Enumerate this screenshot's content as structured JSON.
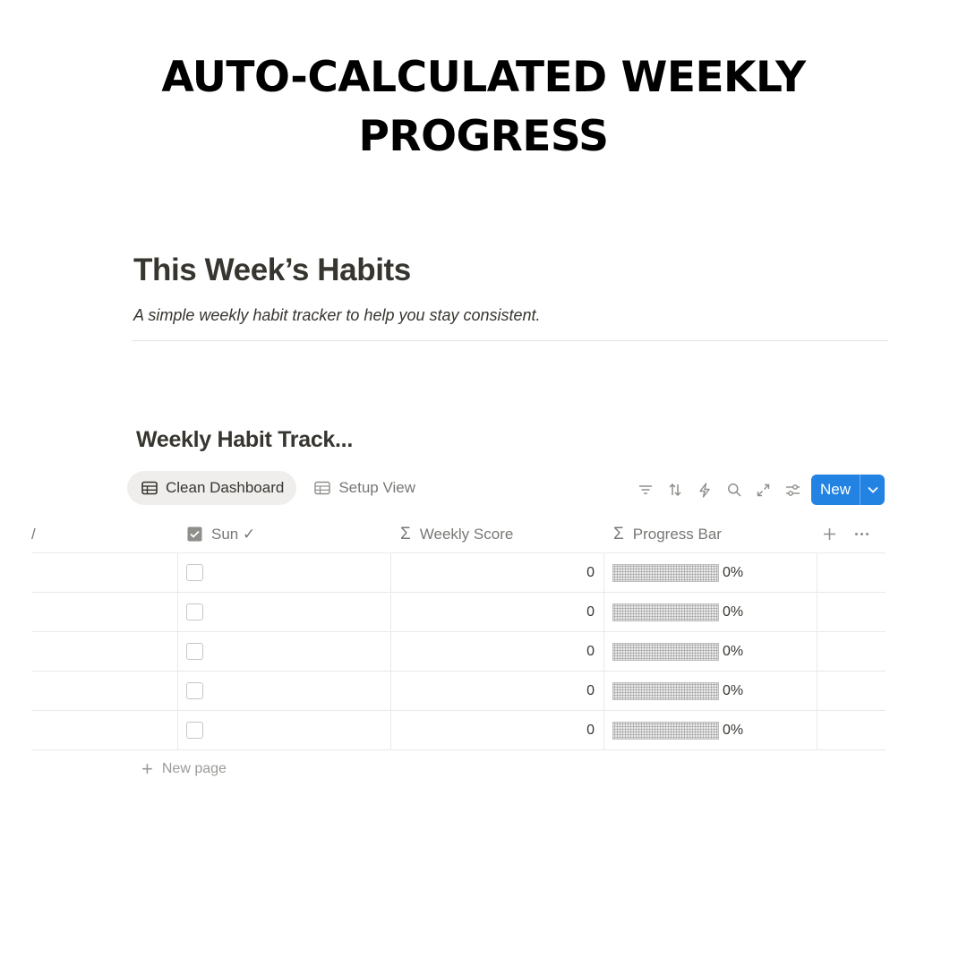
{
  "banner": {
    "line1": "AUTO-CALCULATED WEEKLY",
    "line2": "PROGRESS"
  },
  "page": {
    "title": "This Week’s Habits",
    "description": "A simple weekly habit tracker to help you stay consistent."
  },
  "database": {
    "title": "Weekly Habit Track...",
    "views": [
      {
        "label": "Clean Dashboard",
        "icon": "table-icon",
        "active": true
      },
      {
        "label": "Setup View",
        "icon": "table-icon",
        "active": false
      }
    ],
    "toolbar": {
      "icons": [
        "filter-icon",
        "sort-icon",
        "automation-icon",
        "search-icon",
        "expand-icon",
        "settings-icon"
      ],
      "new_label": "New"
    },
    "columns": {
      "partial": "/",
      "sun": "Sun ✓",
      "weekly_score": "Weekly Score",
      "progress_bar": "Progress Bar"
    },
    "rows": [
      {
        "sun": false,
        "score": "0",
        "progress": "0%",
        "progress_value": 0
      },
      {
        "sun": false,
        "score": "0",
        "progress": "0%",
        "progress_value": 0
      },
      {
        "sun": false,
        "score": "0",
        "progress": "0%",
        "progress_value": 0
      },
      {
        "sun": false,
        "score": "0",
        "progress": "0%",
        "progress_value": 0
      },
      {
        "sun": false,
        "score": "0",
        "progress": "0%",
        "progress_value": 0
      }
    ],
    "new_page_label": "New page"
  },
  "colors": {
    "accent": "#2383e2",
    "text": "#37352f",
    "muted": "#787774"
  }
}
